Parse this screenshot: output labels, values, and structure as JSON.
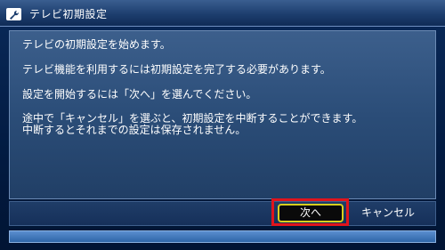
{
  "window": {
    "title": "テレビ初期設定",
    "icon": "wrench-icon"
  },
  "message": {
    "lines": [
      "テレビの初期設定を始めます。",
      "テレビ機能を利用するには初期設定を完了する必要があります。",
      "設定を開始するには「次へ」を選んでください。",
      "途中で「キャンセル」を選ぶと、初期設定を中断することができます。",
      "中断するとそれまでの設定は保存されません。"
    ]
  },
  "buttons": {
    "next_label": "次へ",
    "cancel_label": "キャンセル"
  },
  "colors": {
    "highlight": "#e0141c",
    "focus_border": "#d8cf1e",
    "panel": "#2b4d78"
  }
}
